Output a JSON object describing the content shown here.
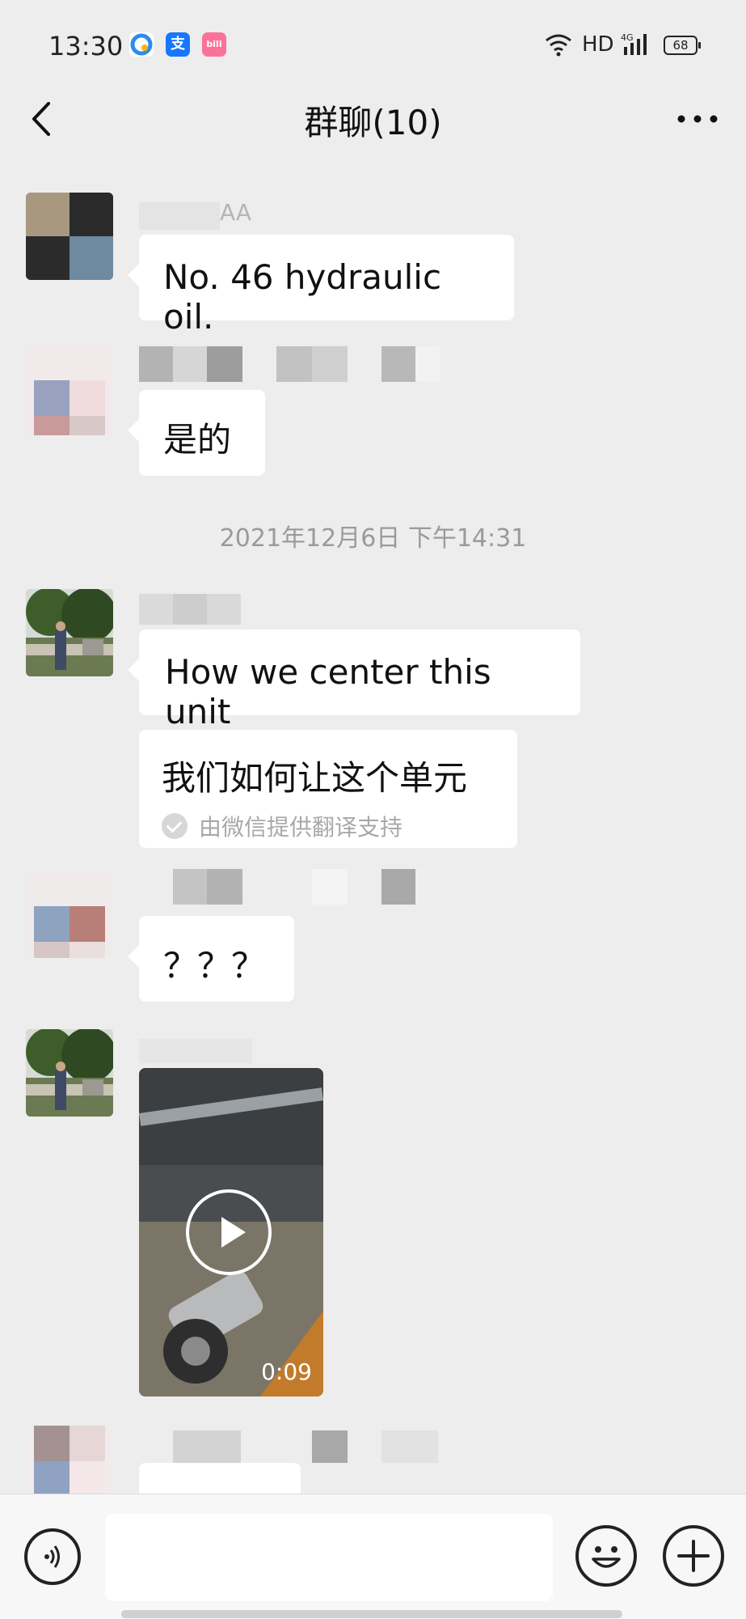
{
  "status_bar": {
    "time": "13:30",
    "network": "HD",
    "signal_type": "4G",
    "battery": "68",
    "icons": [
      "qq-browser-icon",
      "alipay-icon",
      "bilibili-icon"
    ]
  },
  "nav": {
    "title": "群聊(10)",
    "back_icon": "chevron-left-icon",
    "more_icon": "more-icon"
  },
  "messages": [
    {
      "type": "text",
      "sender": "AA",
      "text": "No. 46 hydraulic oil."
    },
    {
      "type": "text",
      "sender": "",
      "text": "是的"
    },
    {
      "type": "timestamp",
      "text": "2021年12月6日 下午14:31"
    },
    {
      "type": "text",
      "sender": "",
      "text": "How we center this unit"
    },
    {
      "type": "translation",
      "text": "我们如何让这个单元",
      "note": "由微信提供翻译支持"
    },
    {
      "type": "text",
      "sender": "",
      "text": "？？？"
    },
    {
      "type": "video",
      "sender": "",
      "duration": "0:09"
    }
  ],
  "colors": {
    "background": "#ededed",
    "bubble": "#ffffff",
    "timestamp_text": "#9a9a9a",
    "input_bar": "#f7f7f7"
  },
  "input_bar": {
    "voice_icon": "voice-icon",
    "emoji_icon": "emoji-icon",
    "add_icon": "plus-icon"
  }
}
